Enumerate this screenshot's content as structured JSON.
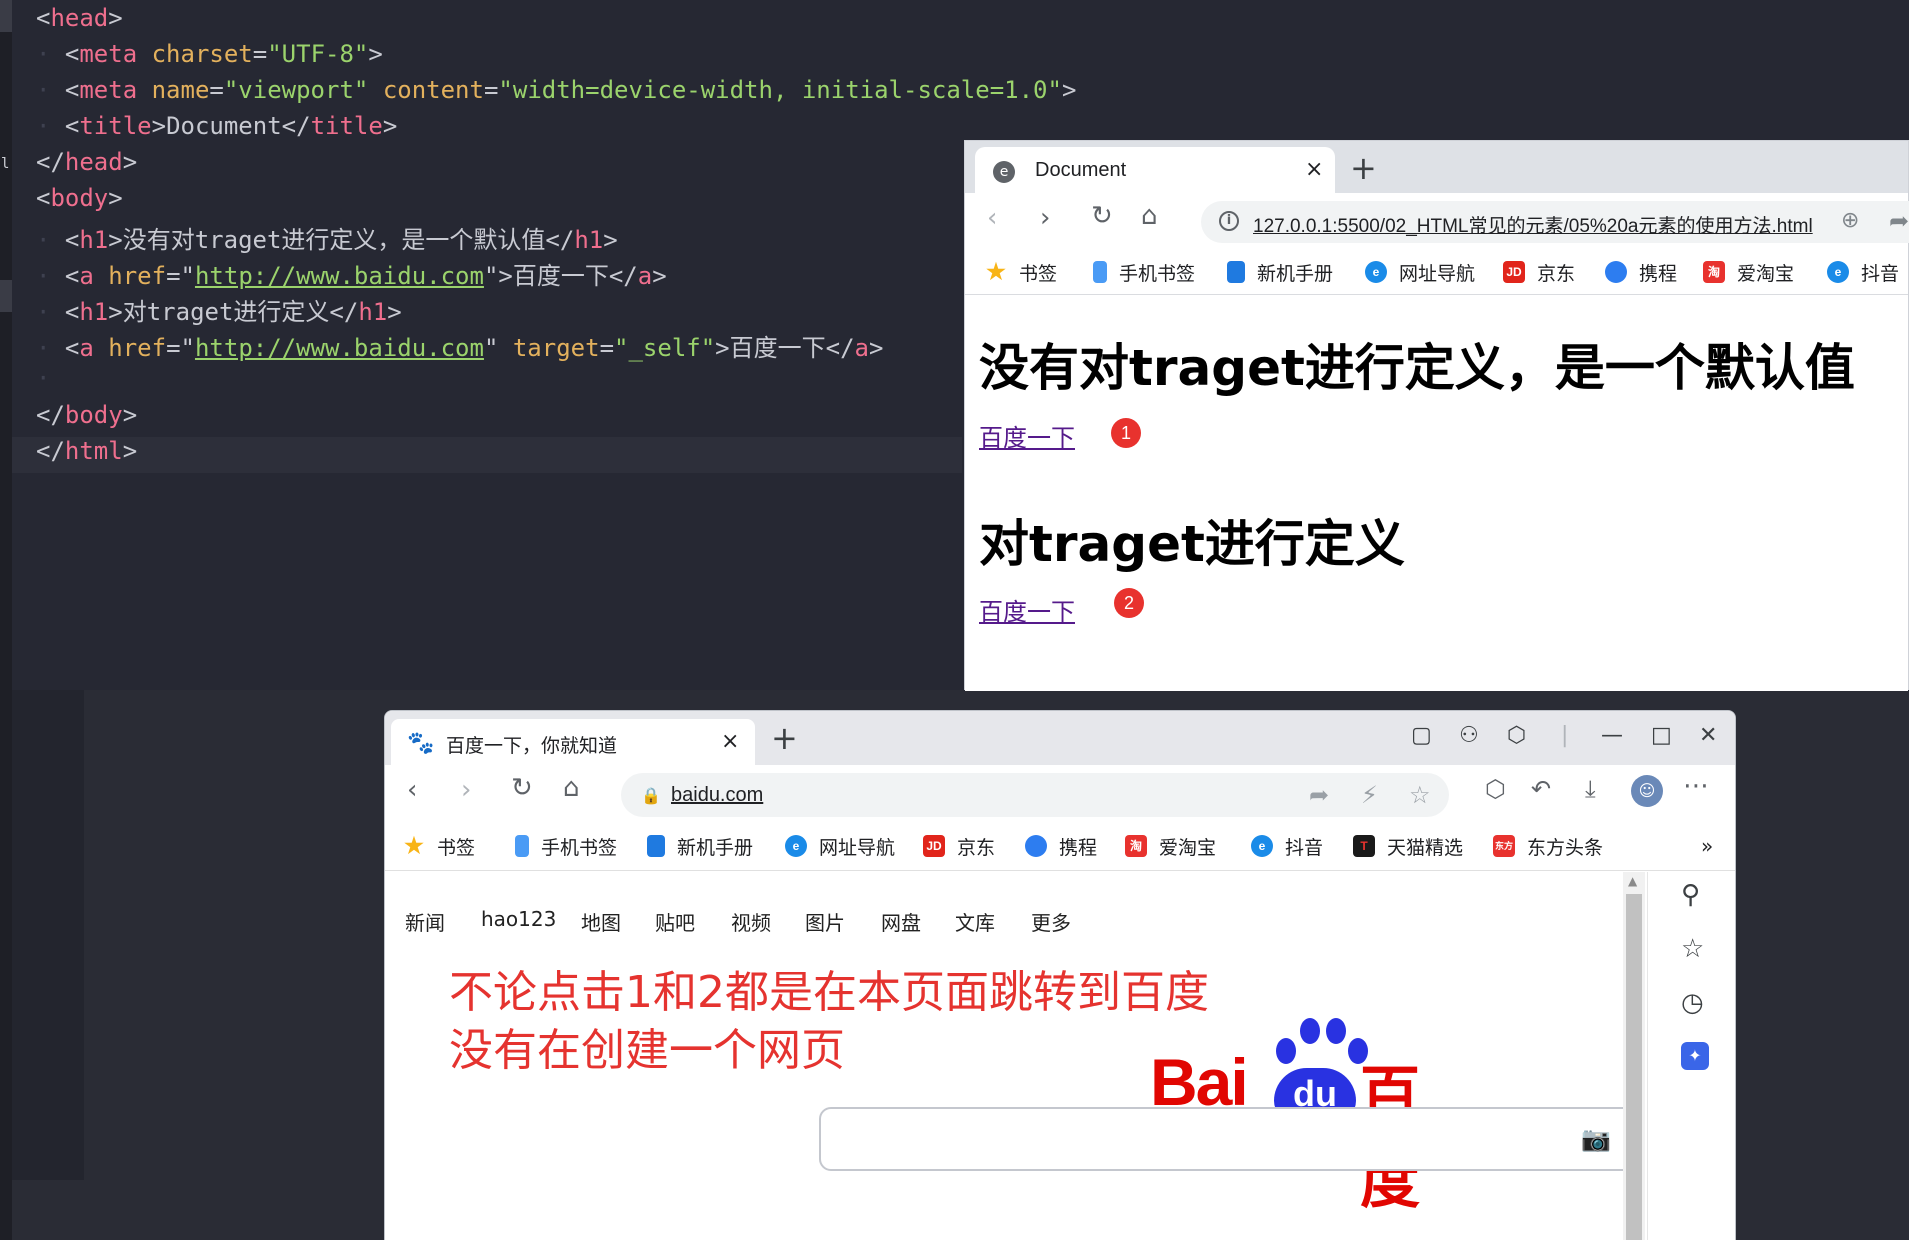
{
  "editor": {
    "lines": {
      "l1": {
        "tag1": "head"
      },
      "l2": {
        "tag": "meta",
        "attr": "charset",
        "value": "\"UTF-8\""
      },
      "l3": {
        "tag": "meta",
        "attr1": "name",
        "value1": "\"viewport\"",
        "attr2": "content",
        "value2": "\"width=device-width, initial-scale=1.0\""
      },
      "l4": {
        "tag": "title",
        "text": "Document"
      },
      "l5": {
        "tag": "head"
      },
      "l6": {
        "tag": "body"
      },
      "l7": {
        "tag": "h1",
        "text": "没有对traget进行定义，是一个默认值"
      },
      "l8": {
        "tag": "a",
        "attr": "href",
        "url": "http://www.baidu.com",
        "text": "百度一下"
      },
      "l9": {
        "tag": "h1",
        "text": "对traget进行定义"
      },
      "l10": {
        "tag": "a",
        "attr": "href",
        "url": "http://www.baidu.com",
        "attr2": "target",
        "value2": "\"_self\"",
        "text": "百度一下"
      },
      "l12": {
        "tag": "body"
      },
      "l13": {
        "tag": "html"
      }
    }
  },
  "browser1": {
    "tab_title": "Document",
    "close_icon": "×",
    "new_tab": "+",
    "url": "127.0.0.1:5500/02_HTML常见的元素/05%20a元素的使用方法.html",
    "bookmarks": [
      {
        "label": "书签",
        "icon": "star-icon",
        "color": "#f8b417"
      },
      {
        "label": "手机书签",
        "icon": "phone-icon",
        "color": "#4a9bf5"
      },
      {
        "label": "新机手册",
        "icon": "manual-icon",
        "color": "#1f7ae0"
      },
      {
        "label": "网址导航",
        "icon": "edge-icon",
        "color": "#1a8be8"
      },
      {
        "label": "京东",
        "icon": "jd-icon",
        "color": "#e1251b",
        "glyph": "JD"
      },
      {
        "label": "携程",
        "icon": "ctrip-icon",
        "color": "#2d7df0"
      },
      {
        "label": "爱淘宝",
        "icon": "taobao-icon",
        "color": "#e8322e",
        "glyph": "淘"
      },
      {
        "label": "抖音",
        "icon": "edge-icon",
        "color": "#1a8be8"
      }
    ],
    "heading1": "没有对traget进行定义，是一个默认值",
    "link1": "百度一下",
    "badge1": "1",
    "heading2": "对traget进行定义",
    "link2": "百度一下",
    "badge2": "2"
  },
  "browser2": {
    "tab_title": "百度一下，你就知道",
    "close_icon": "×",
    "new_tab": "+",
    "url": "baidu.com",
    "bookmarks": [
      {
        "label": "书签",
        "icon": "star-icon",
        "color": "#f8b417"
      },
      {
        "label": "手机书签",
        "icon": "phone-icon",
        "color": "#4a9bf5"
      },
      {
        "label": "新机手册",
        "icon": "manual-icon",
        "color": "#1f7ae0"
      },
      {
        "label": "网址导航",
        "icon": "edge-icon",
        "color": "#1a8be8"
      },
      {
        "label": "京东",
        "icon": "jd-icon",
        "color": "#e1251b",
        "glyph": "JD"
      },
      {
        "label": "携程",
        "icon": "ctrip-icon",
        "color": "#2d7df0"
      },
      {
        "label": "爱淘宝",
        "icon": "taobao-icon",
        "color": "#e8322e",
        "glyph": "淘"
      },
      {
        "label": "抖音",
        "icon": "edge-icon",
        "color": "#1a8be8"
      },
      {
        "label": "天猫精选",
        "icon": "tmall-icon",
        "color": "#1a1a1a",
        "glyph": "T"
      },
      {
        "label": "东方头条",
        "icon": "toutiao-icon",
        "color": "#e8322e",
        "glyph": "东方"
      }
    ],
    "more_bookmarks": "»",
    "nav_links": [
      "新闻",
      "hao123",
      "地图",
      "贴吧",
      "视频",
      "图片",
      "网盘",
      "文库",
      "更多"
    ],
    "annotation_line1": "不论点击1和2都是在本页面跳转到百度",
    "annotation_line2": "没有在创建一个网页",
    "logo_text": "Bai",
    "logo_du": "du",
    "logo_cn": "百度"
  },
  "colors": {
    "editor_bg": "#262833",
    "annotation_red": "#e5332f",
    "badge_red": "#e8322e",
    "baidu_blue": "#2932e1",
    "baidu_red": "#e10602"
  }
}
